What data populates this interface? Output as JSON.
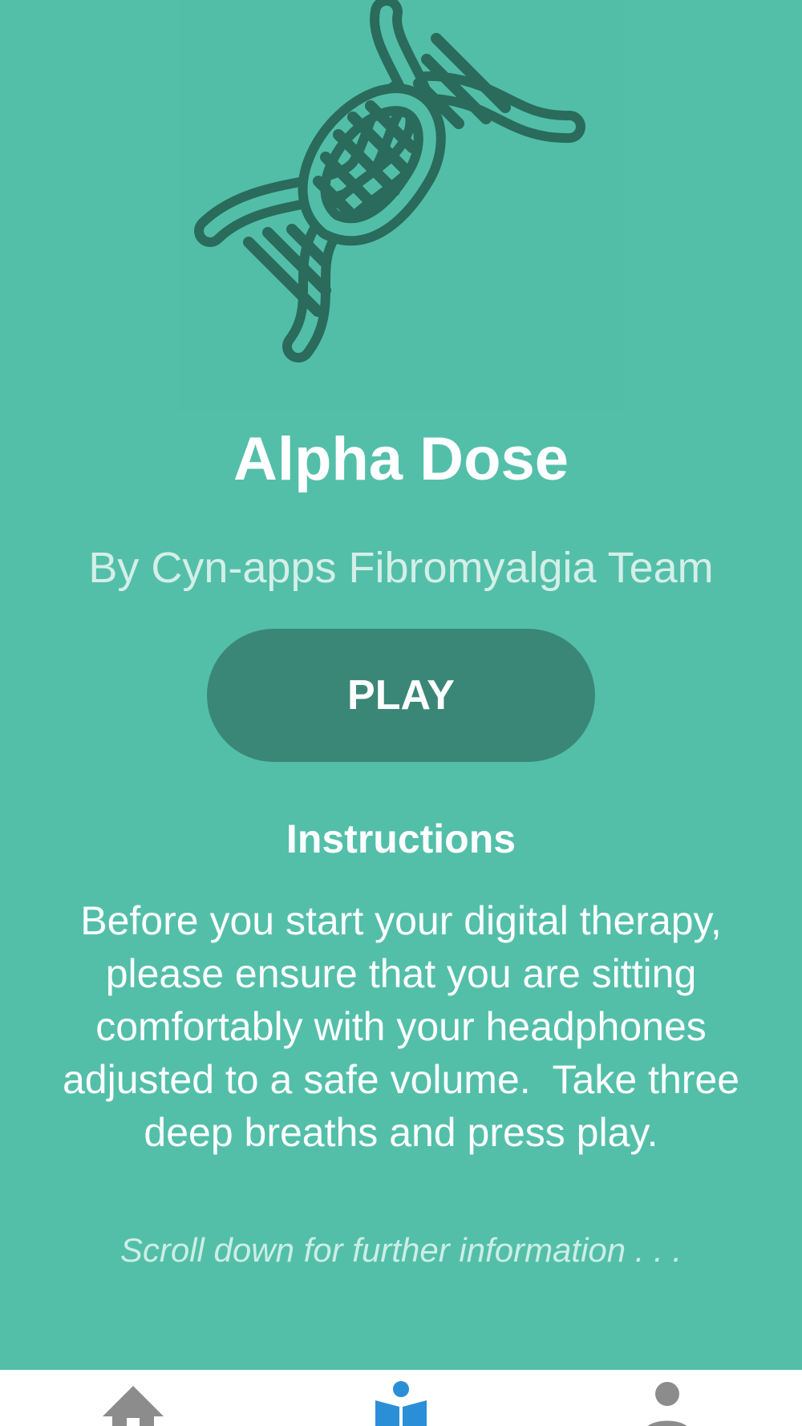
{
  "app": {
    "title": "Alpha Dose",
    "author": "By Cyn-apps Fibromyalgia Team",
    "play_label": "PLAY"
  },
  "instructions": {
    "heading": "Instructions",
    "lines": [
      "Before you start your digital therapy,",
      "please ensure that you are sitting",
      "comfortably with your headphones",
      "adjusted to a safe volume.  Take three",
      "deep breaths and press play."
    ]
  },
  "scroll_hint": "Scroll down for further information . . .",
  "hero": {
    "icon": "dna-icon",
    "color": "#2a6b5c"
  },
  "colors": {
    "background": "#53bfa9",
    "button": "#3a8777",
    "nav_active": "#2b8fd8",
    "nav_inactive": "#8c8c8c"
  },
  "bottom_nav": {
    "items": [
      {
        "icon": "home-icon",
        "active": false
      },
      {
        "icon": "reader-icon",
        "active": true
      },
      {
        "icon": "person-icon",
        "active": false
      }
    ]
  }
}
